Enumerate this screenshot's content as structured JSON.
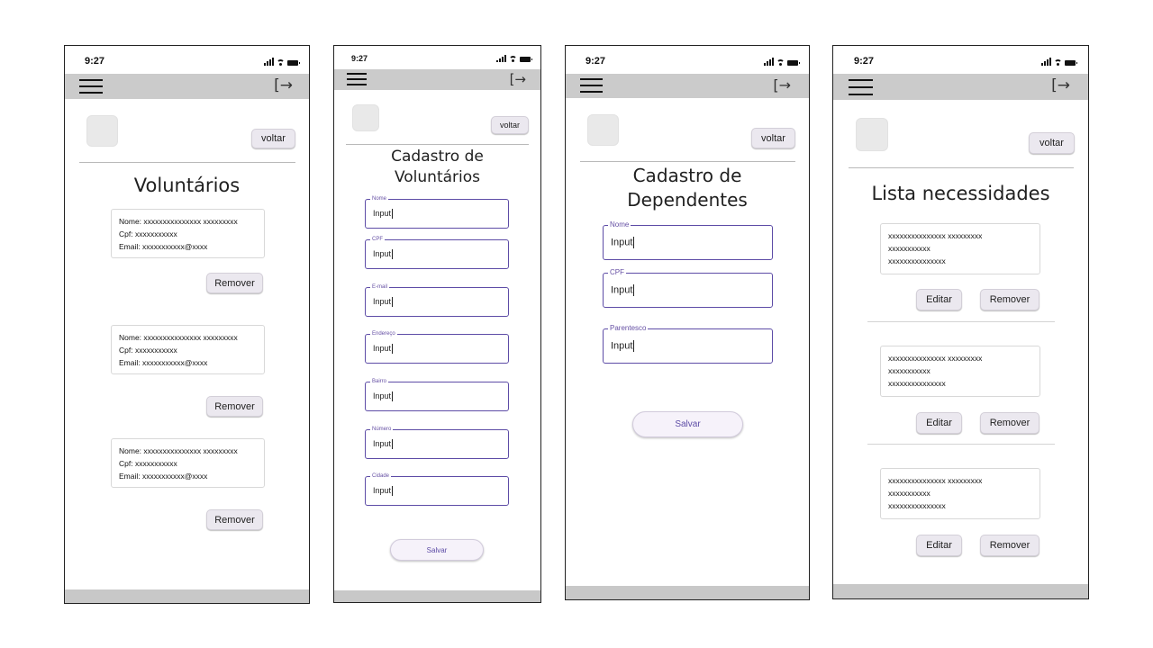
{
  "status": {
    "time": "9:27"
  },
  "screens": {
    "voluntarios": {
      "back_label": "voltar",
      "title": "Voluntários",
      "cards": [
        {
          "line1": "Nome: xxxxxxxxxxxxxxx xxxxxxxxx",
          "line2": "Cpf: xxxxxxxxxxx",
          "line3": "Email: xxxxxxxxxxx@xxxx",
          "remove_label": "Remover"
        },
        {
          "line1": "Nome: xxxxxxxxxxxxxxx xxxxxxxxx",
          "line2": "Cpf: xxxxxxxxxxx",
          "line3": "Email: xxxxxxxxxxx@xxxx",
          "remove_label": "Remover"
        },
        {
          "line1": "Nome: xxxxxxxxxxxxxxx xxxxxxxxx",
          "line2": "Cpf: xxxxxxxxxxx",
          "line3": "Email: xxxxxxxxxxx@xxxx",
          "remove_label": "Remover"
        }
      ]
    },
    "cadastro_voluntarios": {
      "back_label": "voltar",
      "title_line1": "Cadastro de",
      "title_line2": "Voluntários",
      "fields": [
        {
          "label": "Nome",
          "value": "Input"
        },
        {
          "label": "CPF",
          "value": "Input"
        },
        {
          "label": "E-mail",
          "value": "Input"
        },
        {
          "label": "Endereço",
          "value": "Input"
        },
        {
          "label": "Bairro",
          "value": "Input"
        },
        {
          "label": "Número",
          "value": "Input"
        },
        {
          "label": "Cidade",
          "value": "Input"
        }
      ],
      "save_label": "Salvar"
    },
    "cadastro_dependentes": {
      "back_label": "voltar",
      "title_line1": "Cadastro de",
      "title_line2": "Dependentes",
      "fields": [
        {
          "label": "Nome",
          "value": "Input"
        },
        {
          "label": "CPF",
          "value": "Input"
        },
        {
          "label": "Parentesco",
          "value": "Input"
        }
      ],
      "save_label": "Salvar"
    },
    "lista_necessidades": {
      "back_label": "voltar",
      "title": "Lista necessidades",
      "cards": [
        {
          "line1": "xxxxxxxxxxxxxxx xxxxxxxxx",
          "line2": "xxxxxxxxxxx",
          "line3": "xxxxxxxxxxxxxxx",
          "edit_label": "Editar",
          "remove_label": "Remover"
        },
        {
          "line1": "xxxxxxxxxxxxxxx xxxxxxxxx",
          "line2": "xxxxxxxxxxx",
          "line3": "xxxxxxxxxxxxxxx",
          "edit_label": "Editar",
          "remove_label": "Remover"
        },
        {
          "line1": "xxxxxxxxxxxxxxx xxxxxxxxx",
          "line2": "xxxxxxxxxxx",
          "line3": "xxxxxxxxxxxxxxx",
          "edit_label": "Editar",
          "remove_label": "Remover"
        }
      ]
    }
  },
  "icons": {
    "menu": "hamburger-menu-icon",
    "logout": "logout-icon"
  },
  "colors": {
    "appbar": "#cbcbcb",
    "accent": "#5d4ca6",
    "footer": "#c8c8c8"
  }
}
